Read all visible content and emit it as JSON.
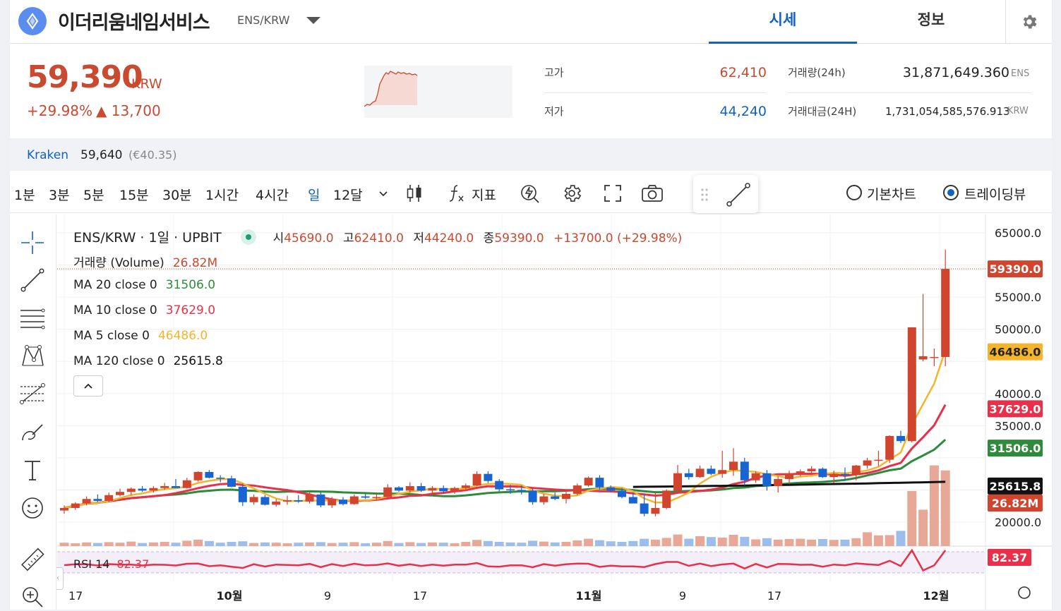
{
  "header": {
    "coin_name": "이더리움네임서비스",
    "pair": "ENS/KRW",
    "tabs": [
      {
        "label": "시세",
        "active": true
      },
      {
        "label": "정보",
        "active": false
      }
    ]
  },
  "price": {
    "current": "59,390",
    "unit": "KRW",
    "change_pct": "+29.98%",
    "change_abs": "▲ 13,700"
  },
  "stats": {
    "high_label": "고가",
    "high_value": "62,410",
    "low_label": "저가",
    "low_value": "44,240",
    "volume_label": "거래량(24h)",
    "volume_value": "31,871,649.360",
    "volume_unit": "ENS",
    "amount_label": "거래대금(24H)",
    "amount_value": "1,731,054,585,576.913",
    "amount_unit": "KRW"
  },
  "exchange": {
    "name": "Kraken",
    "price": "59,640",
    "eur": "(€40.35)"
  },
  "toolbar": {
    "timeframes": [
      "1분",
      "3분",
      "5분",
      "15분",
      "30분",
      "1시간",
      "4시간",
      "일",
      "12달"
    ],
    "active_timeframe": "일",
    "indicator_label": "지표",
    "chart_modes": [
      "기본차트",
      "트레이딩뷰"
    ],
    "active_mode": "트레이딩뷰"
  },
  "legend": {
    "symbol": "ENS/KRW · 1일 · UPBIT",
    "ohlc": {
      "open_label": "시",
      "open": "45690.0",
      "high_label": "고",
      "high": "62410.0",
      "low_label": "저",
      "low": "44240.0",
      "close_label": "종",
      "close": "59390.0",
      "change": "+13700.0 (+29.98%)"
    },
    "volume": {
      "label": "거래량 (Volume)",
      "value": "26.82M"
    },
    "ma20": {
      "label": "MA 20 close 0",
      "value": "31506.0"
    },
    "ma10": {
      "label": "MA 10 close 0",
      "value": "37629.0"
    },
    "ma5": {
      "label": "MA 5 close 0",
      "value": "46486.0"
    },
    "ma120": {
      "label": "MA 120 close 0",
      "value": "25615.8"
    },
    "rsi": {
      "label": "RSI 14",
      "value": "82.37"
    }
  },
  "colors": {
    "up": "#d1452f",
    "down": "#1764d2",
    "ma5": "#f4b52b",
    "ma10": "#e8304a",
    "ma20": "#2e8b3a",
    "ma120": "#111111",
    "accent": "#1261c4"
  },
  "chart_data": {
    "type": "candlestick",
    "y_ticks": [
      "65000.0",
      "55000.0",
      "50000.0",
      "40000.0",
      "35000.0",
      "20000.0"
    ],
    "x_ticks": [
      "17",
      "10월",
      "9",
      "17",
      "11월",
      "9",
      "17",
      "12월"
    ],
    "ylim": [
      15000,
      70000
    ],
    "price_tags": [
      {
        "value": "59390.0",
        "series": "close"
      },
      {
        "value": "46486.0",
        "series": "ma5"
      },
      {
        "value": "37629.0",
        "series": "ma10"
      },
      {
        "value": "31506.0",
        "series": "ma20"
      },
      {
        "value": "25615.8",
        "series": "ma120"
      },
      {
        "value": "26.82M",
        "series": "volume"
      },
      {
        "value": "82.37",
        "series": "rsi"
      }
    ],
    "candles": [
      [
        21800,
        22600,
        21300,
        22200
      ],
      [
        22200,
        23100,
        21900,
        22900
      ],
      [
        22900,
        24000,
        22600,
        23600
      ],
      [
        23600,
        24300,
        23100,
        23300
      ],
      [
        23300,
        24600,
        23100,
        24200
      ],
      [
        24200,
        25200,
        24000,
        24700
      ],
      [
        24700,
        25400,
        24200,
        25200
      ],
      [
        25200,
        25600,
        24700,
        24900
      ],
      [
        24900,
        25600,
        24600,
        25300
      ],
      [
        25300,
        26100,
        25000,
        25600
      ],
      [
        25600,
        26700,
        25300,
        25300
      ],
      [
        25300,
        26900,
        25200,
        26500
      ],
      [
        26500,
        27900,
        26300,
        27800
      ],
      [
        27800,
        28100,
        26800,
        26900
      ],
      [
        26900,
        27300,
        26200,
        26800
      ],
      [
        26800,
        27200,
        25400,
        25500
      ],
      [
        25500,
        26000,
        22500,
        23100
      ],
      [
        23100,
        24300,
        22700,
        23900
      ],
      [
        23900,
        24200,
        22600,
        22700
      ],
      [
        22700,
        23600,
        22400,
        23200
      ],
      [
        23200,
        24100,
        22700,
        23400
      ],
      [
        23400,
        24200,
        23000,
        23200
      ],
      [
        23200,
        24600,
        22900,
        24300
      ],
      [
        24300,
        24700,
        22300,
        22600
      ],
      [
        22600,
        23900,
        22200,
        23500
      ],
      [
        23500,
        23900,
        22600,
        22800
      ],
      [
        22800,
        24300,
        22700,
        24000
      ],
      [
        24000,
        24400,
        23600,
        23800
      ],
      [
        23800,
        24500,
        23500,
        23900
      ],
      [
        23900,
        25900,
        23800,
        25400
      ],
      [
        25400,
        25600,
        24700,
        24900
      ],
      [
        24900,
        26200,
        24600,
        25600
      ],
      [
        25600,
        26100,
        24700,
        24900
      ],
      [
        24900,
        25600,
        24300,
        25300
      ],
      [
        25300,
        25700,
        24500,
        24800
      ],
      [
        24800,
        25500,
        24400,
        25300
      ],
      [
        25300,
        26000,
        24900,
        25700
      ],
      [
        25700,
        27900,
        25600,
        27500
      ],
      [
        27500,
        27900,
        26100,
        26400
      ],
      [
        26400,
        26700,
        24800,
        25100
      ],
      [
        25100,
        25800,
        24400,
        25000
      ],
      [
        25000,
        25700,
        24300,
        24900
      ],
      [
        24900,
        25300,
        22700,
        23100
      ],
      [
        23100,
        24400,
        22700,
        24000
      ],
      [
        24000,
        24600,
        23400,
        23600
      ],
      [
        23600,
        24700,
        22900,
        24400
      ],
      [
        24400,
        26000,
        24200,
        25700
      ],
      [
        25700,
        27100,
        25500,
        26900
      ],
      [
        26900,
        27300,
        25000,
        25400
      ],
      [
        25400,
        25700,
        24600,
        24900
      ],
      [
        24900,
        25300,
        23700,
        23900
      ],
      [
        23900,
        24600,
        22900,
        22900
      ],
      [
        22900,
        24300,
        20900,
        21300
      ],
      [
        21300,
        24500,
        20900,
        22200
      ],
      [
        22200,
        25100,
        22000,
        24900
      ],
      [
        24900,
        28900,
        24700,
        27600
      ],
      [
        27600,
        28300,
        26600,
        27000
      ],
      [
        27000,
        28800,
        26900,
        28300
      ],
      [
        28300,
        28800,
        27300,
        27500
      ],
      [
        27500,
        31100,
        26900,
        28100
      ],
      [
        28100,
        31500,
        27200,
        29400
      ],
      [
        29400,
        30000,
        25700,
        26500
      ],
      [
        26500,
        27900,
        26100,
        27600
      ],
      [
        27600,
        28100,
        24900,
        25600
      ],
      [
        25600,
        27100,
        24600,
        26700
      ],
      [
        26700,
        28000,
        25900,
        27600
      ],
      [
        27600,
        28200,
        27100,
        27900
      ],
      [
        27900,
        28700,
        27400,
        28300
      ],
      [
        28300,
        28500,
        26900,
        27000
      ],
      [
        27000,
        28000,
        26100,
        27500
      ],
      [
        27500,
        28500,
        26500,
        27300
      ],
      [
        27300,
        28900,
        26500,
        28800
      ],
      [
        28800,
        30000,
        28300,
        29600
      ],
      [
        29600,
        31100,
        28700,
        29700
      ],
      [
        29700,
        33500,
        29200,
        33400
      ],
      [
        33400,
        34200,
        32300,
        32600
      ],
      [
        32600,
        50300,
        32400,
        50300
      ],
      [
        45300,
        55500,
        45000,
        45800
      ],
      [
        45690,
        47000,
        44240,
        45690
      ],
      [
        45690,
        62410,
        44240,
        59390
      ]
    ],
    "volume": [
      1.2,
      1.0,
      1.3,
      1.1,
      1.4,
      1.2,
      1.6,
      1.1,
      1.3,
      1.5,
      1.2,
      1.9,
      2.3,
      1.8,
      1.2,
      1.5,
      1.7,
      1.1,
      1.3,
      1.2,
      1.0,
      1.2,
      1.3,
      1.4,
      1.1,
      1.2,
      1.4,
      1.0,
      1.2,
      1.8,
      1.1,
      1.4,
      1.1,
      1.3,
      1.2,
      1.0,
      1.5,
      2.2,
      1.8,
      1.5,
      1.3,
      1.2,
      1.9,
      1.6,
      1.3,
      1.5,
      2.0,
      2.6,
      2.1,
      1.7,
      1.5,
      1.8,
      2.6,
      2.3,
      2.9,
      4.1,
      2.6,
      3.5,
      3.2,
      3.0,
      4.0,
      3.3,
      2.4,
      2.8,
      2.3,
      2.5,
      2.6,
      2.3,
      2.5,
      2.2,
      2.3,
      2.8,
      4.9,
      3.8,
      3.9,
      5.4,
      19.5,
      12.9,
      28.6,
      26.82
    ],
    "volume_max": 40
  }
}
